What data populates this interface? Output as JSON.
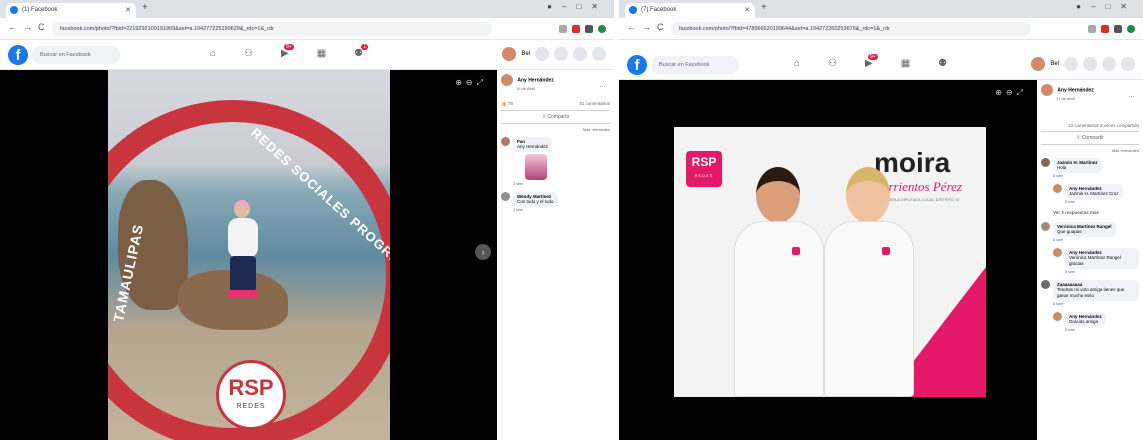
{
  "colors": {
    "facebook_blue": "#1877f2",
    "rsp_red": "#c9353c",
    "moira_pink": "#e6186a",
    "viewer_bg": "#000000"
  },
  "left": {
    "tab_title": "(1) Facebook",
    "url": "facebook.com/photo/?fbid=2219292100191909&set=a.104277225190629&_rdc=1&_rdr",
    "fb_search_placeholder": "Buscar en Facebook",
    "user_short": "Bel",
    "nav_badge": "9+",
    "nav_badge2": "1",
    "photo": {
      "ring_top": "REDES SOCIALES PROGRESISTAS",
      "ring_left": "TAMAULIPAS",
      "logo": "RSP",
      "logo_sub": "REDES"
    },
    "panel": {
      "author": "Any Hernández",
      "time": "19 de Abril",
      "reactions_count": "78",
      "comments_count": "21 comentarios",
      "share_label": "Compartir",
      "relevance": "Más relevantes",
      "comments": [
        {
          "name": "Fan",
          "text": "Any Hernández",
          "meta": "2 sem"
        },
        {
          "name": "Wendy Martínez",
          "text": "Con todo y el todo",
          "meta": "2 sem"
        }
      ]
    }
  },
  "right": {
    "tab_title": "(7) Facebook",
    "url": "facebook.com/photo/?fbid=478966520199644&set=a.104272260253676&_rdc=1&_rdr",
    "fb_search_placeholder": "Buscar en Facebook",
    "user_short": "Bel",
    "nav_badge": "9+",
    "photo": {
      "name_big": "moira",
      "name_script": "Barrientos Pérez",
      "caption": "CANDIDATA A DIPUTADA LOCAL DISTRITO XI",
      "badge": "RSP",
      "badge_sub": "REDES"
    },
    "panel": {
      "author": "Any Hernández",
      "time": "17 de abril",
      "comments_count": "13 comentarios 2 veces compartido",
      "share_label": "Compartir",
      "relevance": "Más relevantes",
      "comments": [
        {
          "name": "Jazmin H. Martínez",
          "text": "Hola",
          "meta": "8 sem"
        },
        {
          "name": "Any Hernández",
          "text": "Jazmin H. Martínez Cruz",
          "meta": "8 sem"
        },
        {
          "name": "Ver 3 respuestas más",
          "text": "",
          "meta": ""
        },
        {
          "name": "Verónica Martínez Rangel",
          "text": "Que guapas",
          "meta": "8 sem"
        },
        {
          "name": "Any Hernández",
          "text": "Verónica Martínez Rangel gracias",
          "meta": "8 sem"
        },
        {
          "name": "Zaaaaaaaaa",
          "text": "Tendras mi voto amiga tienes que ganar mucho exito",
          "meta": "8 sem"
        },
        {
          "name": "Any Hernández",
          "text": "Gracias amiga",
          "meta": "8 sem"
        }
      ]
    }
  }
}
